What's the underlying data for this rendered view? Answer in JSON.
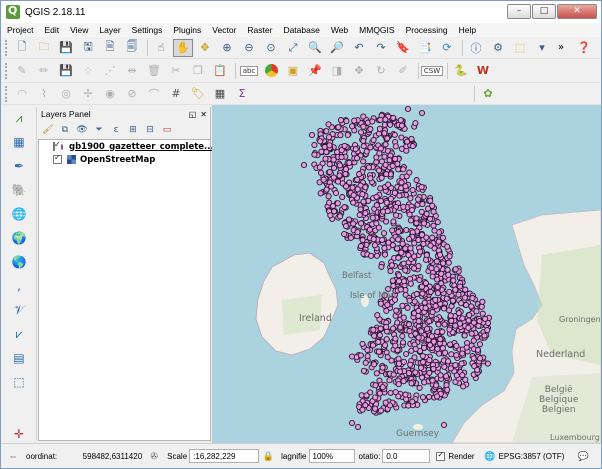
{
  "window": {
    "title": "QGIS 2.18.11",
    "minimize": "–",
    "maximize": "□",
    "close": "✕"
  },
  "menubar": [
    "Project",
    "Edit",
    "View",
    "Layer",
    "Settings",
    "Plugins",
    "Vector",
    "Raster",
    "Database",
    "Web",
    "MMQGIS",
    "Processing",
    "Help"
  ],
  "toolbar": {
    "overflow": "»",
    "csw": "CSW",
    "abc": "abc"
  },
  "layers_panel": {
    "title": "Layers Panel",
    "float_btn": "◱",
    "close_btn": "✕",
    "layers": [
      {
        "name": "gb1900_gazetteer_complete...",
        "checked": true,
        "symbol": "point"
      },
      {
        "name": "OpenStreetMap",
        "checked": true,
        "symbol": "raster"
      }
    ]
  },
  "map": {
    "labels": [
      "Belfast",
      "Isle of Man",
      "Ireland",
      "Nederland",
      "België / Belgique / Belgien",
      "Luxembourg",
      "Guernsey",
      "Groningen"
    ],
    "belgium_lines": [
      "België",
      "Belgique",
      "Belgien"
    ],
    "point_color": "#e39ee3",
    "point_stroke": "#2a102a",
    "land_color": "#f2efe9",
    "water_color": "#aad3df",
    "green_color": "#c8dfb4"
  },
  "statusbar": {
    "coordinate_label": "oordinat:",
    "coordinate_value": "598482,6311420",
    "scale_label": "Scale",
    "scale_value": ":16,282,229",
    "magnifier_label": "lagnifie",
    "magnifier_value": "100%",
    "rotation_label": "otatio:",
    "rotation_value": "0.0",
    "render_label": "Render",
    "crs_label": "EPSG:3857 (OTF)"
  }
}
